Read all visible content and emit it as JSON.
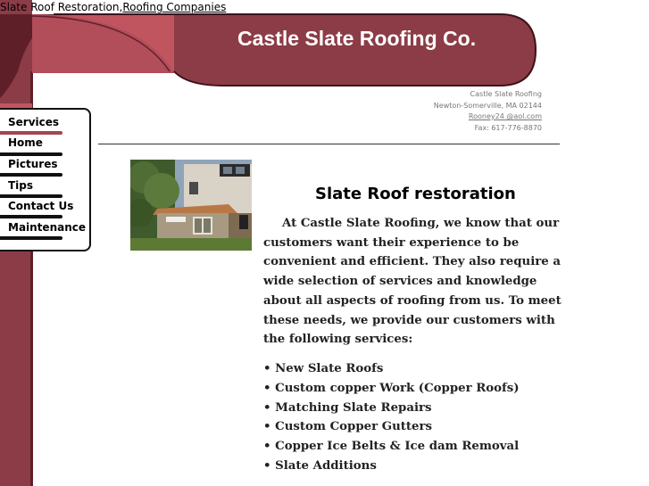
{
  "top_links": {
    "text1": "Slate Roof Restoration",
    "sep": ",",
    "text2": "Roofing Companies"
  },
  "header": {
    "title": "Castle Slate Roofing Co."
  },
  "contact": {
    "name": "Castle Slate Roofing",
    "location": "Newton-Somerville,  MA  02144",
    "email": "Rooney24 @aol.com",
    "fax": "Fax: 617-776-8870"
  },
  "nav": {
    "items": [
      "Services",
      "Home",
      "Pictures",
      "Tips",
      "Contact Us",
      "Maintenance"
    ]
  },
  "main": {
    "heading": "Slate Roof restoration",
    "intro": "At Castle Slate Roofing, we know that our customers want their experience to be convenient and efficient. They also require a wide selection of services and knowledge about all aspects of roofing from us. To meet these needs, we provide our customers with the following services:",
    "services": [
      "• New Slate Roofs",
      "• Custom copper Work (Copper Roofs)",
      "• Matching Slate Repairs",
      "• Custom Copper Gutters",
      "• Copper Ice Belts & Ice dam Removal",
      "• Slate Additions"
    ]
  },
  "colors": {
    "maroon": "#8c3c46",
    "pink": "#c05560",
    "dark": "#5e1f29"
  }
}
